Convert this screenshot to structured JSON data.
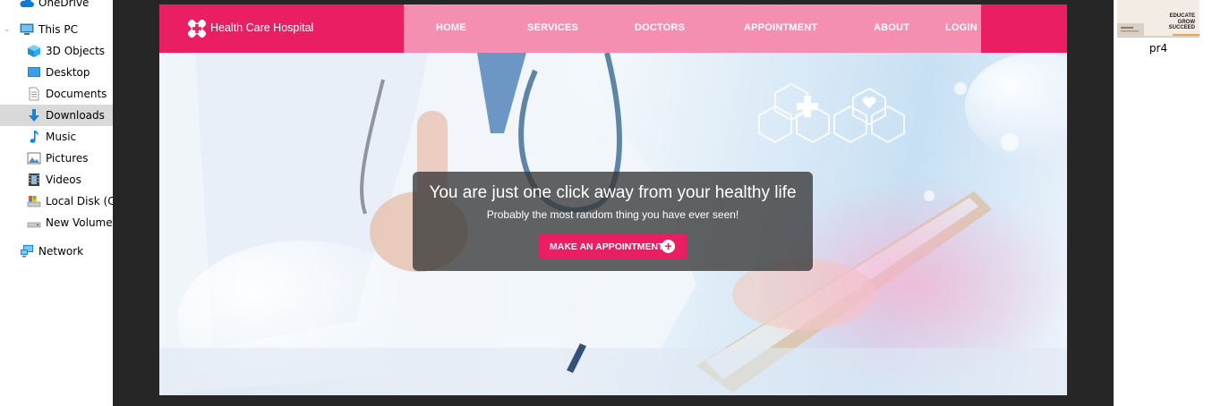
{
  "explorer": {
    "items": [
      {
        "label": "OneDrive",
        "icon": "cloud-icon",
        "expandable": false
      },
      {
        "label": "This PC",
        "icon": "computer-icon",
        "expandable": true
      },
      {
        "label": "3D Objects",
        "icon": "cube-icon",
        "expandable": false
      },
      {
        "label": "Desktop",
        "icon": "desktop-icon",
        "expandable": false
      },
      {
        "label": "Documents",
        "icon": "document-icon",
        "expandable": false
      },
      {
        "label": "Downloads",
        "icon": "download-arrow-icon",
        "expandable": false,
        "selected": true
      },
      {
        "label": "Music",
        "icon": "music-note-icon",
        "expandable": false
      },
      {
        "label": "Pictures",
        "icon": "pictures-icon",
        "expandable": false
      },
      {
        "label": "Videos",
        "icon": "film-icon",
        "expandable": false
      },
      {
        "label": "Local Disk (C:)",
        "icon": "drive-icon",
        "expandable": false
      },
      {
        "label": "New Volume (",
        "icon": "drive-icon",
        "expandable": false
      },
      {
        "label": "Network",
        "icon": "network-icon",
        "expandable": false
      }
    ]
  },
  "site": {
    "brand": "Health Care Hospital",
    "menu": [
      "HOME",
      "SERVICES",
      "DOCTORS",
      "APPOINTMENT",
      "ABOUT",
      "LOGIN"
    ],
    "hero": {
      "title": "You are just one click away from your healthy life",
      "subtitle": "Probably the most random thing you have ever seen!",
      "button": "MAKE AN APPOINTMENT"
    },
    "colors": {
      "primary": "#e91e63",
      "menu_bg": "#f48fb1",
      "overlay": "#373737"
    }
  },
  "thumbnail": {
    "label": "pr4",
    "lines": [
      "EDUCATE",
      "GROW",
      "SUCCEED"
    ]
  }
}
